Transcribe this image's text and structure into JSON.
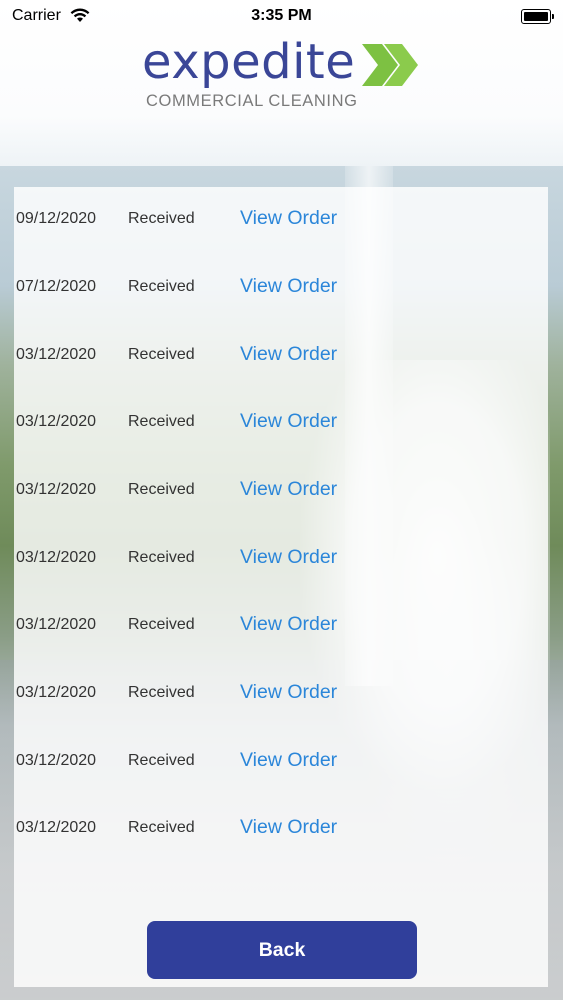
{
  "status_bar": {
    "carrier": "Carrier",
    "time": "3:35 PM",
    "wifi_icon": "wifi-icon",
    "battery_icon": "battery-icon"
  },
  "logo": {
    "word": "expedite",
    "tagline": "COMMERCIAL CLEANING",
    "brand_color": "#3a4697",
    "accent_color": "#7dc142"
  },
  "orders": [
    {
      "date": "09/12/2020",
      "status": "Received",
      "action": "View Order"
    },
    {
      "date": "07/12/2020",
      "status": "Received",
      "action": "View Order"
    },
    {
      "date": "03/12/2020",
      "status": "Received",
      "action": "View Order"
    },
    {
      "date": "03/12/2020",
      "status": "Received",
      "action": "View Order"
    },
    {
      "date": "03/12/2020",
      "status": "Received",
      "action": "View Order"
    },
    {
      "date": "03/12/2020",
      "status": "Received",
      "action": "View Order"
    },
    {
      "date": "03/12/2020",
      "status": "Received",
      "action": "View Order"
    },
    {
      "date": "03/12/2020",
      "status": "Received",
      "action": "View Order"
    },
    {
      "date": "03/12/2020",
      "status": "Received",
      "action": "View Order"
    },
    {
      "date": "03/12/2020",
      "status": "Received",
      "action": "View Order"
    }
  ],
  "footer": {
    "back_label": "Back"
  },
  "colors": {
    "link": "#2b86d9",
    "button": "#303f9b"
  }
}
